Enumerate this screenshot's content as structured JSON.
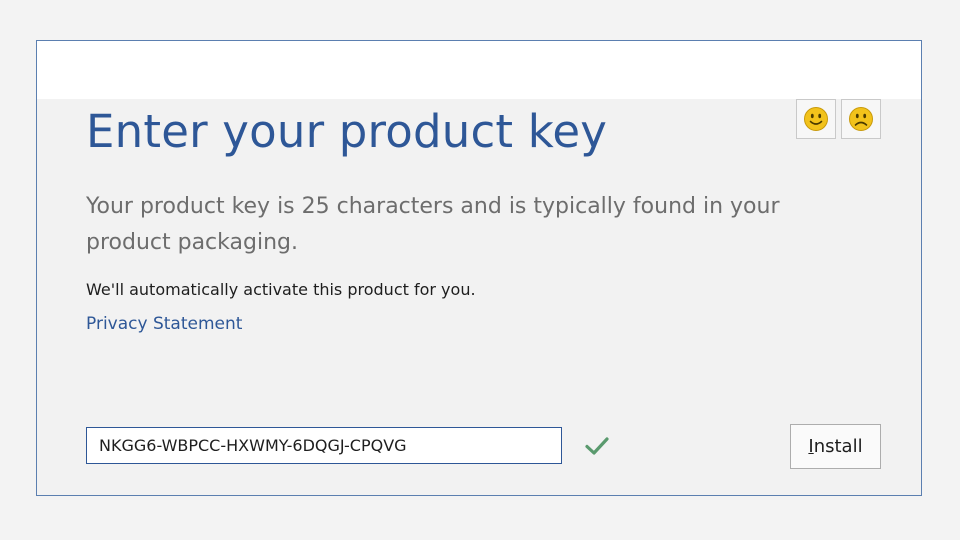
{
  "dialog": {
    "title": "Enter your product key",
    "description": "Your product key is 25 characters and is typically found in your product packaging.",
    "activation_note": "We'll automatically activate this product for you.",
    "privacy_link": "Privacy Statement",
    "product_key_value": "NKGG6-WBPCC-HXWMY-6DQGJ-CPQVG",
    "key_valid": true,
    "install_label_accel": "I",
    "install_label_rest": "nstall"
  },
  "feedback": {
    "smile_icon": "smiley-face-icon",
    "frown_icon": "frowning-face-icon"
  },
  "colors": {
    "accent": "#2e5797",
    "check": "#5a9a6e",
    "emoji": "#f2c21b"
  }
}
